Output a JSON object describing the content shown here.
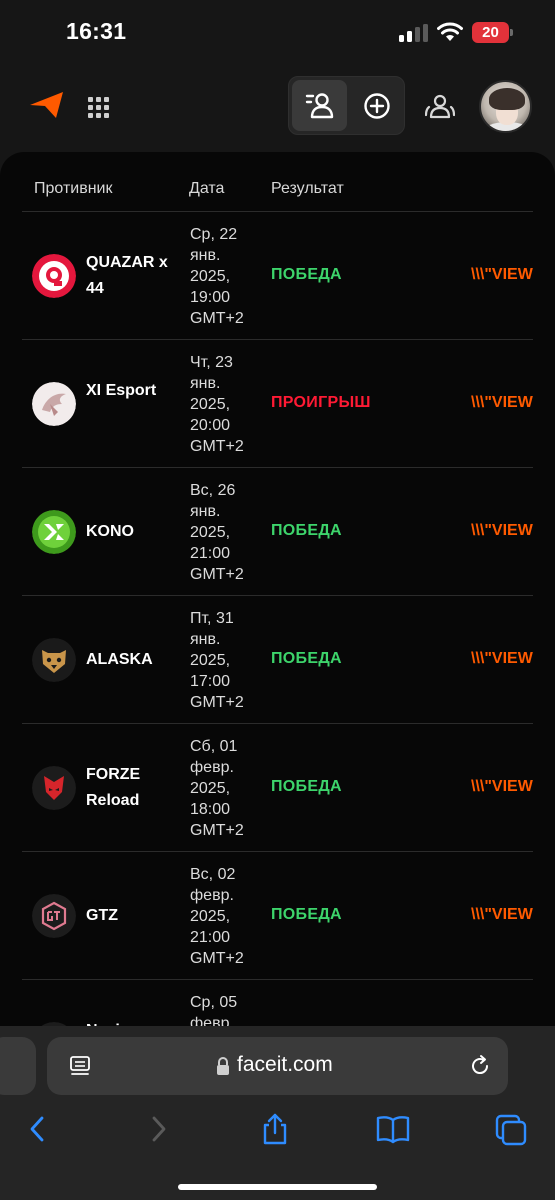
{
  "status_bar": {
    "time": "16:31",
    "battery": "20"
  },
  "header": {
    "logo": "faceit-logo-icon",
    "apps": "grid-apps-icon",
    "toggle_left": "find-players-icon",
    "toggle_right": "plus-circle-icon",
    "party": "party-icon",
    "avatar": "user-avatar"
  },
  "table": {
    "columns": [
      "Противник",
      "Дата",
      "Результат"
    ],
    "rows": [
      {
        "team": "QUAZAR x 44",
        "date": "Ср, 22 янв. 2025, 19:00 GMT+2",
        "result": "ПОБЕДА",
        "status": "win",
        "view": "\\\\\\\"VIEW",
        "logo": "quazar-logo-icon"
      },
      {
        "team": "XI Esport",
        "date": "Чт, 23 янв. 2025, 20:00 GMT+2",
        "result": "ПРОИГРЫШ",
        "status": "loss",
        "view": "\\\\\\\"VIEW",
        "logo": "xi-esport-logo-icon"
      },
      {
        "team": "KONO",
        "date": "Вс, 26 янв. 2025, 21:00 GMT+2",
        "result": "ПОБЕДА",
        "status": "win",
        "view": "\\\\\\\"VIEW",
        "logo": "kono-logo-icon"
      },
      {
        "team": "ALASKA",
        "date": "Пт, 31 янв. 2025, 17:00 GMT+2",
        "result": "ПОБЕДА",
        "status": "win",
        "view": "\\\\\\\"VIEW",
        "logo": "alaska-logo-icon"
      },
      {
        "team": "FORZE Reload",
        "date": "Сб, 01 февр. 2025, 18:00 GMT+2",
        "result": "ПОБЕДА",
        "status": "win",
        "view": "\\\\\\\"VIEW",
        "logo": "forze-logo-icon"
      },
      {
        "team": "GTZ",
        "date": "Вс, 02 февр. 2025, 21:00 GMT+2",
        "result": "ПОБЕДА",
        "status": "win",
        "view": "\\\\\\\"VIEW",
        "logo": "gtz-logo-icon"
      },
      {
        "team": "Navi",
        "date": "Ср, 05 февр.",
        "result": "",
        "status": "win",
        "view": "",
        "logo": "partial-team-logo-icon"
      }
    ]
  },
  "browser": {
    "url": "faceit.com",
    "icons": [
      "reader-icon",
      "lock-icon",
      "reload-icon",
      "back-icon",
      "forward-icon",
      "share-icon",
      "bookmarks-icon",
      "tabs-icon"
    ]
  },
  "colors": {
    "win": "#3dd46b",
    "loss": "#ff1a34",
    "accent": "#ff5a00"
  }
}
